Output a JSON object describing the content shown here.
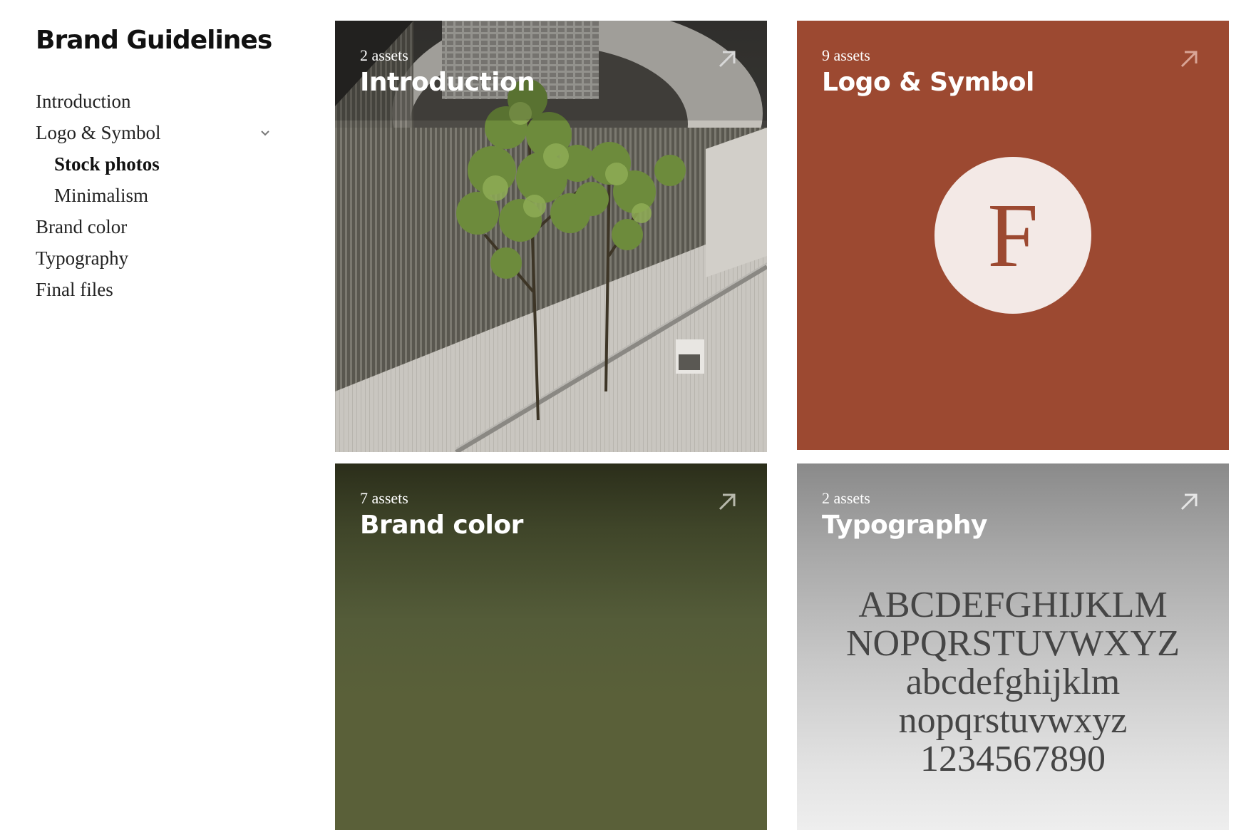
{
  "sidebar": {
    "title": "Brand Guidelines",
    "items": [
      {
        "label": "Introduction"
      },
      {
        "label": "Logo & Symbol"
      },
      {
        "label": "Stock photos"
      },
      {
        "label": "Minimalism"
      },
      {
        "label": "Brand color"
      },
      {
        "label": "Typography"
      },
      {
        "label": "Final files"
      }
    ]
  },
  "cards": [
    {
      "count": "2 assets",
      "title": "Introduction"
    },
    {
      "count": "9 assets",
      "title": "Logo & Symbol",
      "logo_letter": "F"
    },
    {
      "count": "7 assets",
      "title": "Brand color"
    },
    {
      "count": "2 assets",
      "title": "Typography",
      "specimen": [
        "ABCDEFGHIJKLM",
        "NOPQRSTUVWXYZ",
        "abcdefghijklm",
        "nopqrstuvwxyz",
        "1234567890"
      ]
    }
  ],
  "colors": {
    "logo_card": "#9c4931",
    "logo_circle": "#f3e9e6",
    "brand_color_card": "#5a6039",
    "typography_text": "#454545"
  },
  "icons": {
    "card_link": "arrow-up-right-icon",
    "expand": "chevron-down-icon"
  }
}
